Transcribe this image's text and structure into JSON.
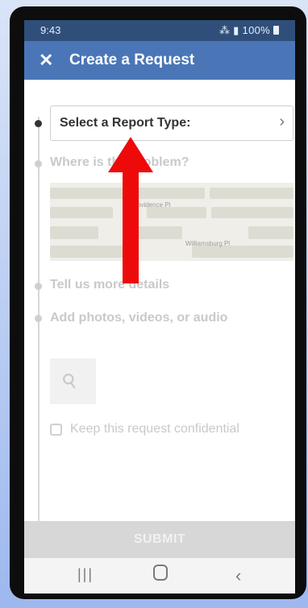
{
  "status_bar": {
    "time": "9:43",
    "indicators": "⌁ᵞ✈ 𝄃 100%",
    "battery": "100%"
  },
  "app_bar": {
    "close_icon": "✕",
    "title": "Create a Request"
  },
  "form": {
    "report_type": {
      "label": "Select a Report Type:",
      "chevron": "›"
    },
    "location": {
      "label": "Where is the problem?",
      "map_streets": [
        "Providence Pl",
        "Williamsburg Pl"
      ]
    },
    "details": {
      "label": "Tell us more details"
    },
    "media": {
      "label": "Add photos, videos, or audio",
      "attach_icon": "paperclip-icon"
    },
    "confidential": {
      "label": "Keep this request confidential"
    }
  },
  "submit": {
    "label": "SUBMIT"
  },
  "nav": {
    "recent": "|||",
    "back": "‹"
  },
  "colors": {
    "app_bar": "#4a76b7",
    "status_bar": "#2f4f7a",
    "annotation_arrow": "#ee0a0a"
  }
}
